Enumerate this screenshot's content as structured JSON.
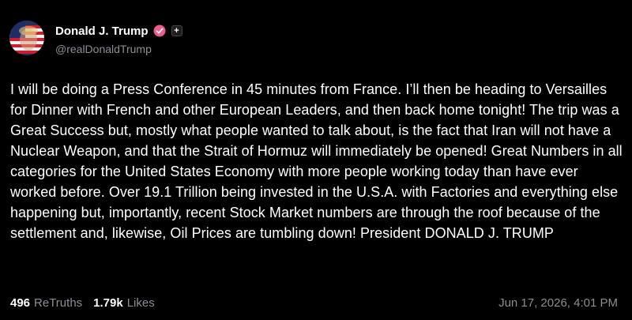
{
  "post": {
    "author": {
      "display_name": "Donald J. Trump",
      "handle": "@realDonaldTrump",
      "verified_icon": "verified-badge-icon",
      "follow_icon": "+",
      "badge_color": "#f05a8c"
    },
    "text": "I will be doing a Press Conference in 45 minutes from France. I’ll then be heading to Versailles for Dinner with French and other European Leaders, and then back home tonight! The trip was a Great Success but, mostly what people wanted to talk about, is the fact that Iran will not have a Nuclear Weapon, and that the Strait of Hormuz will immediately be opened! Great Numbers in all categories for the United States Economy with more people working today than have ever worked before. Over 19.1 Trillion being invested in the U.S.A. with Factories and everything else happening but, importantly, recent Stock Market numbers are through the roof because of the settlement and, likewise, Oil Prices are tumbling down! President DONALD J. TRUMP",
    "stats": {
      "retruths_count": "496",
      "retruths_label": "ReTruths",
      "likes_count": "1.79k",
      "likes_label": "Likes"
    },
    "timestamp": "Jun 17, 2026, 4:01 PM"
  }
}
